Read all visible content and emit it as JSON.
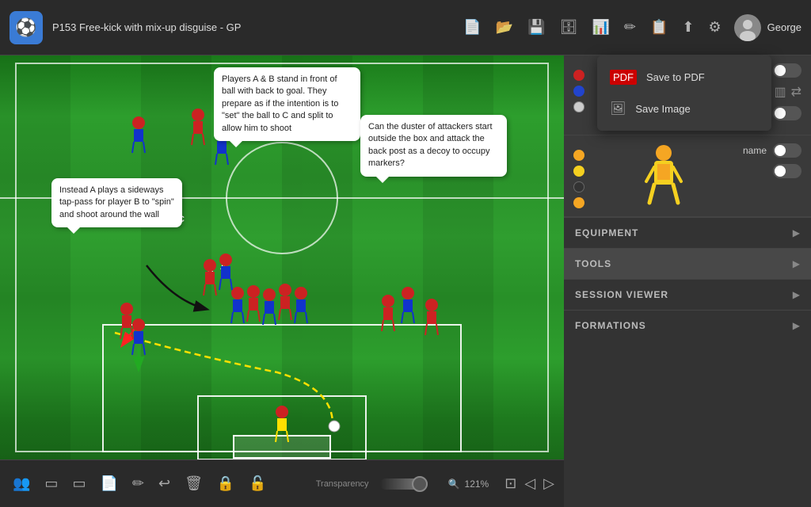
{
  "app": {
    "logo": "⚽",
    "title": "P153 Free-kick with mix-up disguise - GP"
  },
  "toolbar": {
    "icons": [
      "📄",
      "📂",
      "💾",
      "💾",
      "📋",
      "📝",
      "📋",
      "⬆",
      "⚙"
    ],
    "user_name": "George"
  },
  "dropdown": {
    "items": [
      {
        "label": "Save to PDF",
        "icon": "PDF"
      },
      {
        "label": "Save Image",
        "icon": "🖼"
      }
    ]
  },
  "field": {
    "bubbles": [
      {
        "id": "bubble1",
        "text": "Instead A plays a sideways tap-pass for player B to \"spin\" and shoot around the wall"
      },
      {
        "id": "bubble2",
        "text": "Players A & B stand in front of ball with back to goal. They prepare as if the intention is to \"set\" the ball to C and split to allow him to shoot"
      },
      {
        "id": "bubble3",
        "text": "Can the duster of attackers start outside the box and attack the back post as a decoy to occupy markers?"
      }
    ]
  },
  "bottombar": {
    "tools": [
      "👥",
      "▭",
      "▭",
      "📄",
      "✏",
      "↩",
      "🗑",
      "🔒",
      "🔓"
    ],
    "transparency_label": "Transparency",
    "zoom": "121%",
    "zoom_icon": "🔍"
  },
  "right_panel": {
    "team1": {
      "colors": [
        "#cc2222",
        "#2244cc",
        "#cccccc"
      ],
      "name_toggle": false
    },
    "team2": {
      "colors": [
        "#f5a623",
        "#f5d020",
        "#333333",
        "#f5a623"
      ],
      "name_label": "name",
      "name_toggle": false
    },
    "sections": [
      {
        "id": "equipment",
        "label": "EQUIPMENT"
      },
      {
        "id": "tools",
        "label": "TOOLS"
      },
      {
        "id": "session-viewer",
        "label": "SESSION VIEWER"
      },
      {
        "id": "formations",
        "label": "FORMATIONS"
      }
    ]
  }
}
